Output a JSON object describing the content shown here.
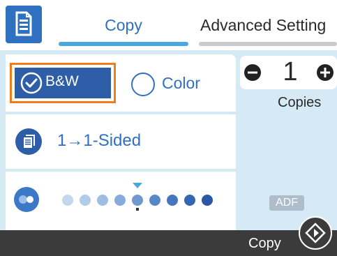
{
  "header": {
    "menu_icon": "document-list-icon",
    "tabs": [
      {
        "label": "Copy",
        "active": true
      },
      {
        "label": "Advanced Setting",
        "active": false
      }
    ]
  },
  "color_mode": {
    "options": [
      {
        "label": "B&W",
        "selected": true,
        "icon": "check-circle-icon"
      },
      {
        "label": "Color",
        "selected": false,
        "icon": "radio-circle-icon"
      }
    ]
  },
  "sides": {
    "label": "1→1-Sided",
    "icon": "page-stack-icon"
  },
  "density": {
    "icon": "density-icon",
    "levels": 9,
    "current_level": 5
  },
  "copies": {
    "value": "1",
    "label": "Copies"
  },
  "adf_badge": "ADF",
  "footer": {
    "label": "Copy",
    "start_icon": "start-diamond-icon"
  },
  "colors": {
    "accent": "#2f70c0",
    "selected_fill": "#2f5ea8",
    "highlight": "#f07c1a",
    "panel": "#d6eaf5",
    "footer": "#3b3b3b"
  }
}
